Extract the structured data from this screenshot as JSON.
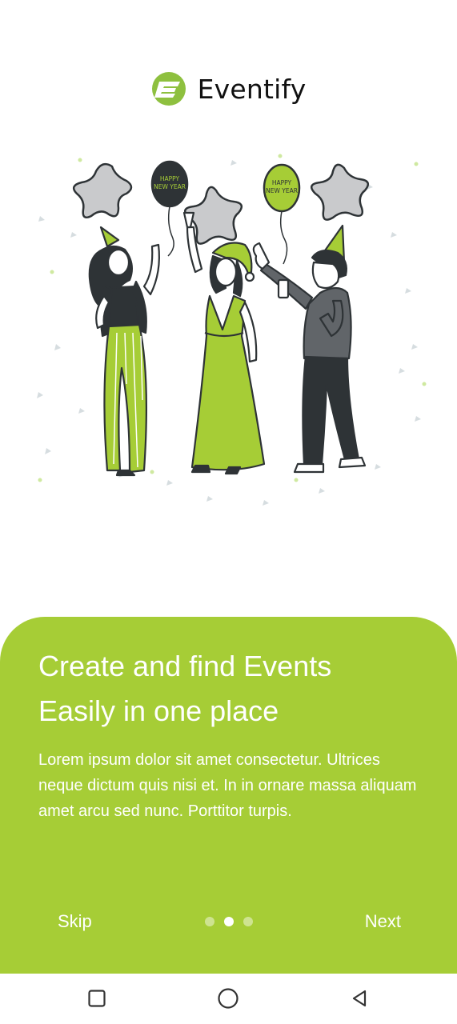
{
  "app": {
    "name": "Eventify",
    "brand_color": "#a6cd36"
  },
  "illustration": {
    "balloon_text": "HAPPY\nNEW YEAR"
  },
  "onboarding": {
    "title": "Create and find Events\nEasily in one place",
    "body": "Lorem ipsum dolor sit amet consectetur. Ultrices neque dictum quis nisi et. In in ornare massa aliquam amet arcu sed nunc. Porttitor turpis.",
    "skip_label": "Skip",
    "next_label": "Next",
    "page_count": 3,
    "current_page": 2
  },
  "navbar": {
    "icons": [
      "square-recent-icon",
      "circle-home-icon",
      "triangle-back-icon"
    ]
  }
}
